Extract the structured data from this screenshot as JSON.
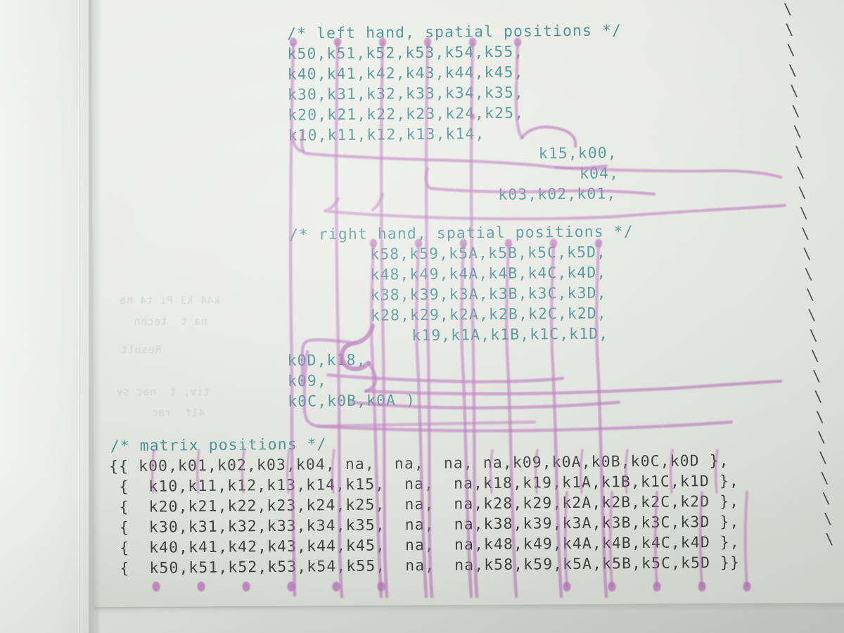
{
  "document": {
    "kind": "printed-source-code-photo",
    "language": "C preprocessor macro",
    "paper_color": "#e8eae3",
    "comment_color": "#3c8c8e",
    "code_color": "#3a3e3c",
    "marker_color": "#b566b8",
    "line_continuation_char": "\\"
  },
  "blocks": [
    {
      "id": "left-hand",
      "comment": "/* left hand, spatial positions */",
      "lines": [
        "k50,k51,k52,k53,k54,k55,",
        "k40,k41,k42,k43,k44,k45,",
        "k30,k31,k32,k33,k34,k35,",
        "k20,k21,k22,k23,k24,k25,",
        "k10,k11,k12,k13,k14,",
        "k15,k00,",
        "k04,",
        "k03,k02,k01,"
      ]
    },
    {
      "id": "right-hand",
      "comment": "/* right hand, spatial positions */",
      "lines": [
        "k58,k59,k5A,k5B,k5C,k5D,",
        "k48,k49,k4A,k4B,k4C,k4D,",
        "k38,k39,k3A,k3B,k3C,k3D,",
        "k28,k29,k2A,k2B,k2C,k2D,",
        "k19,k1A,k1B,k1C,k1D,",
        "k0D,k18,",
        "k09,",
        "k0C,k0B,k0A )"
      ]
    },
    {
      "id": "matrix",
      "comment": "/* matrix positions */",
      "lines": [
        "{{ k00,k01,k02,k03,k04, na,  na,  na, na,k09,k0A,k0B,k0C,k0D },",
        " {  k10,k11,k12,k13,k14,k15,  na,  na,k18,k19,k1A,k1B,k1C,k1D },",
        " {  k20,k21,k22,k23,k24,k25,  na,  na,k28,k29,k2A,k2B,k2C,k2D },",
        " {  k30,k31,k32,k33,k34,k35,  na,  na,k38,k39,k3A,k3B,k3C,k3D },",
        " {  k40,k41,k42,k43,k44,k45,  na,  na,k48,k49,k4A,k4B,k4C,k4D },",
        " {  k50,k51,k52,k53,k54,k55,  na,  na,k58,k59,k5A,k5B,k5C,k5D }}"
      ]
    }
  ],
  "matrix_table": {
    "rows": [
      [
        "k00",
        "k01",
        "k02",
        "k03",
        "k04",
        "na",
        "na",
        "na",
        "na",
        "k09",
        "k0A",
        "k0B",
        "k0C",
        "k0D"
      ],
      [
        "k10",
        "k11",
        "k12",
        "k13",
        "k14",
        "k15",
        "na",
        "na",
        "k18",
        "k19",
        "k1A",
        "k1B",
        "k1C",
        "k1D"
      ],
      [
        "k20",
        "k21",
        "k22",
        "k23",
        "k24",
        "k25",
        "na",
        "na",
        "k28",
        "k29",
        "k2A",
        "k2B",
        "k2C",
        "k2D"
      ],
      [
        "k30",
        "k31",
        "k32",
        "k33",
        "k34",
        "k35",
        "na",
        "na",
        "k38",
        "k39",
        "k3A",
        "k3B",
        "k3C",
        "k3D"
      ],
      [
        "k40",
        "k41",
        "k42",
        "k43",
        "k44",
        "k45",
        "na",
        "na",
        "k48",
        "k49",
        "k4A",
        "k4B",
        "k4C",
        "k4D"
      ],
      [
        "k50",
        "k51",
        "k52",
        "k53",
        "k54",
        "k55",
        "na",
        "na",
        "k58",
        "k59",
        "k5A",
        "k5B",
        "k5C",
        "k5D"
      ]
    ]
  },
  "annotations": {
    "tool": "pink highlighter pen",
    "description": "hand-drawn lines connecting spatial-position columns to matrix-position columns",
    "dot_count_left": 6,
    "dot_count_right": 6
  }
}
